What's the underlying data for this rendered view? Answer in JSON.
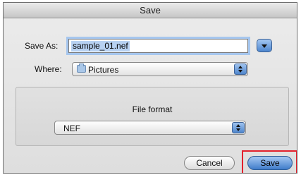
{
  "dialog": {
    "title": "Save",
    "save_as_label": "Save As:",
    "filename_value": "sample_01.nef",
    "where_label": "Where:",
    "where_value": "Pictures",
    "file_format_label": "File format",
    "file_format_value": "NEF",
    "cancel_label": "Cancel",
    "save_label": "Save"
  },
  "icons": {
    "disclosure": "disclosure-triangle-icon",
    "folder": "folder-icon",
    "popup_arrows": "updown-arrows-icon"
  },
  "colors": {
    "focus_ring": "#a6c6ee",
    "default_button": "#4f86cc",
    "annotation_highlight": "#e3202c"
  }
}
